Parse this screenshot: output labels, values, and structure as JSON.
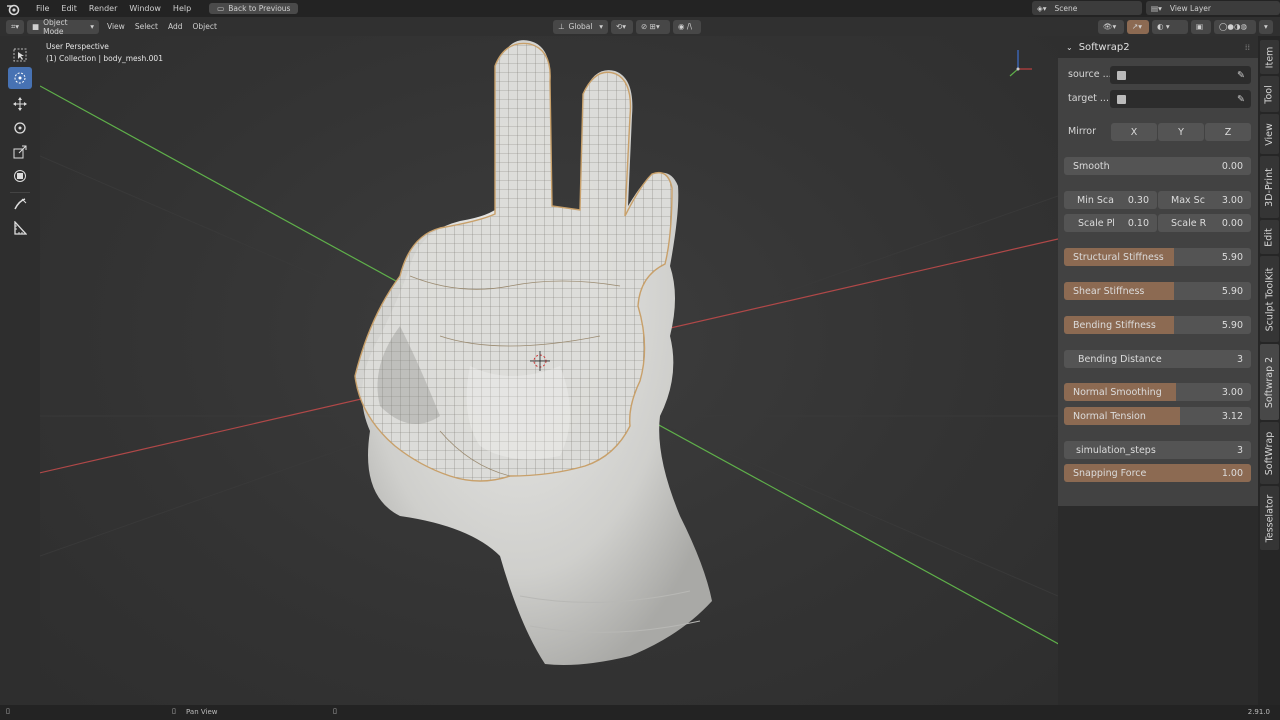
{
  "topbar": {
    "menus": [
      "File",
      "Edit",
      "Render",
      "Window",
      "Help"
    ],
    "back_button": "Back to Previous",
    "scene": "Scene",
    "view_layer": "View Layer"
  },
  "header": {
    "mode": "Object Mode",
    "menus": [
      "View",
      "Select",
      "Add",
      "Object"
    ],
    "orientation": "Global"
  },
  "viewport": {
    "perspective": "User Perspective",
    "collection": "(1) Collection | body_mesh.001"
  },
  "panel": {
    "title": "Softwrap2",
    "source_label": "source ...",
    "target_label": "target ...",
    "mirror_label": "Mirror",
    "mirror_axes": [
      "X",
      "Y",
      "Z"
    ],
    "smooth": {
      "label": "Smooth",
      "value": "0.00"
    },
    "min_scale": {
      "label": "Min Sca",
      "value": "0.30"
    },
    "max_scale": {
      "label": "Max Sc",
      "value": "3.00"
    },
    "scale_pl": {
      "label": "Scale Pl",
      "value": "0.10"
    },
    "scale_r": {
      "label": "Scale R",
      "value": "0.00"
    },
    "structural_stiffness": {
      "label": "Structural Stiffness",
      "value": "5.90",
      "fill": 0.59
    },
    "shear_stiffness": {
      "label": "Shear Stiffness",
      "value": "5.90",
      "fill": 0.59
    },
    "bending_stiffness": {
      "label": "Bending Stiffness",
      "value": "5.90",
      "fill": 0.59
    },
    "bending_distance": {
      "label": "Bending Distance",
      "value": "3"
    },
    "normal_smoothing": {
      "label": "Normal Smoothing",
      "value": "3.00",
      "fill": 0.6
    },
    "normal_tension": {
      "label": "Normal Tension",
      "value": "3.12",
      "fill": 0.62
    },
    "simulation_steps": {
      "label": "simulation_steps",
      "value": "3"
    },
    "snapping_force": {
      "label": "Snapping Force",
      "value": "1.00",
      "fill": 1.0
    }
  },
  "tabs": [
    "Item",
    "Tool",
    "View",
    "3D-Print",
    "Edit",
    "Sculpt ToolKit",
    "Softwrap 2",
    "SoftWrap",
    "Tesselator"
  ],
  "status": {
    "pan_view": "Pan View",
    "version": "2.91.0"
  },
  "colors": {
    "accent": "#4772b3",
    "slider_fill": "#8c6a52",
    "x_axis": "#c05050",
    "y_axis": "#5fb04a",
    "mesh": "#d9d9d6",
    "wire": "#c8a06a"
  }
}
